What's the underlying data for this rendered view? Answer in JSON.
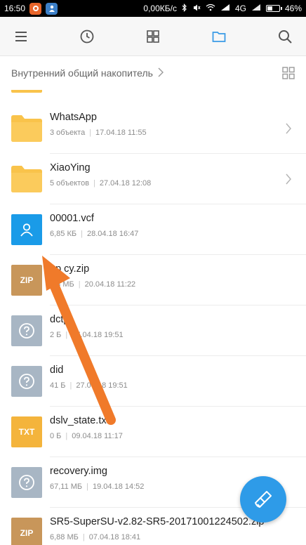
{
  "status": {
    "time": "16:50",
    "speed": "0,00КБ/с",
    "network": "4G",
    "battery": "46%",
    "battery_level": 0.46
  },
  "toolbar": {
    "menu_icon": "menu-icon",
    "recent_icon": "clock-icon",
    "categories_icon": "grid-icon",
    "folder_icon": "folder-icon",
    "search_icon": "search-icon",
    "active_color": "#3a9be6"
  },
  "breadcrumb": {
    "label": "Внутренний общий накопитель"
  },
  "files": [
    {
      "name": "WhatsApp",
      "count": "3 объекта",
      "date": "17.04.18 11:55",
      "type": "folder"
    },
    {
      "name": "XiaoYing",
      "count": "5 объектов",
      "date": "27.04.18 12:08",
      "type": "folder"
    },
    {
      "name": "00001.vcf",
      "size": "6,85 КБ",
      "date": "28.04.18 16:47",
      "type": "contact"
    },
    {
      "name": "ер cy.zip",
      "size": "4,3 МБ",
      "date": "20.04.18 11:22",
      "type": "zip",
      "badge": "ZIP"
    },
    {
      "name": "dctp",
      "size": "2 Б",
      "date": "27.04.18 19:51",
      "type": "unknown"
    },
    {
      "name": "did",
      "size": "41 Б",
      "date": "27.04.18 19:51",
      "type": "unknown"
    },
    {
      "name": "dslv_state.txt",
      "size": "0 Б",
      "date": "09.04.18 11:17",
      "type": "txt",
      "badge": "TXT"
    },
    {
      "name": "recovery.img",
      "size": "67,11 МБ",
      "date": "19.04.18 14:52",
      "type": "unknown"
    },
    {
      "name": "SR5-SuperSU-v2.82-SR5-20171001224502.zip",
      "size": "6,88 МБ",
      "date": "07.04.18 18:41",
      "type": "zip",
      "badge": "ZIP"
    }
  ],
  "fab": {
    "icon": "broom-icon",
    "color": "#2e9be8"
  },
  "colors": {
    "folder": "#f9c34b",
    "arrow": "#f07a2a"
  }
}
